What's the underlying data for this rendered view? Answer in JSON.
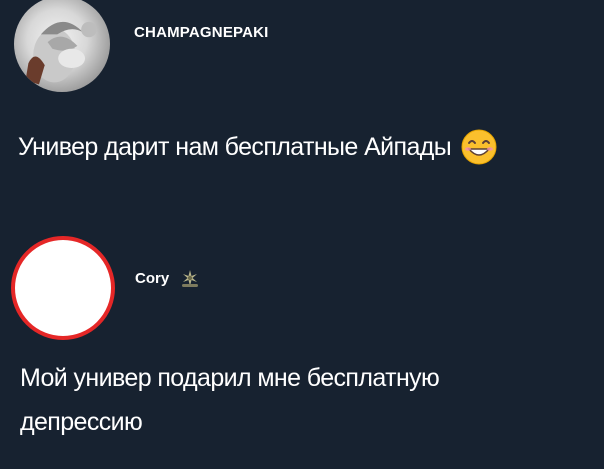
{
  "colors": {
    "background": "#172230",
    "text": "#ffffff",
    "avatar_highlight": "#e52727"
  },
  "post1": {
    "username": "CHAMPAGNEPAKI",
    "avatar_icon": "profile-photo",
    "text": "Универ дарит нам бесплатные Айпады",
    "emoji_icon": "smiling-face-with-smiling-eyes-icon"
  },
  "post2": {
    "username": "Cory",
    "badge_icon": "sparkle-badge-icon",
    "text": "Мой универ подарил мне бесплатную депрессию"
  }
}
